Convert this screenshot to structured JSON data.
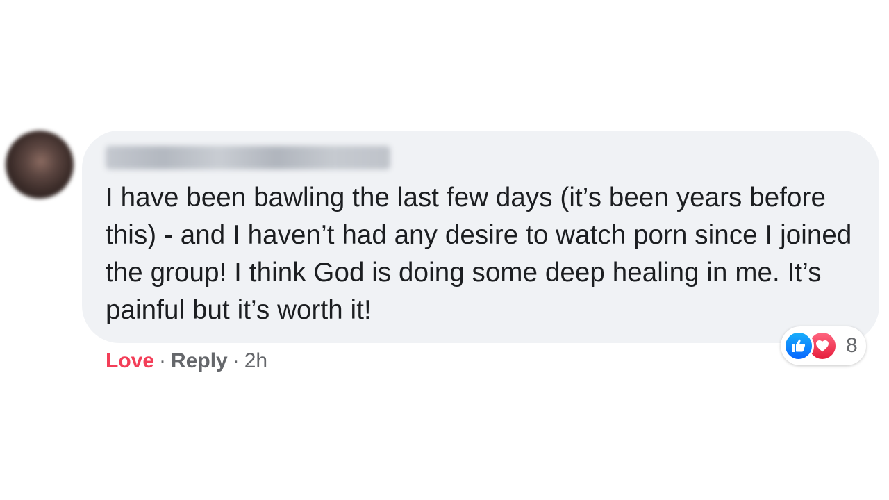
{
  "comment": {
    "author_name": "",
    "text": "I have been bawling the last few days (it’s been years before this) - and I haven’t had any desire to watch porn since I joined the group! I think God is doing some deep healing in me. It’s painful but it’s worth it!",
    "actions": {
      "love_label": "Love",
      "separator": "·",
      "reply_label": "Reply",
      "timestamp": "2h"
    },
    "reactions": {
      "icons": [
        "like-icon",
        "love-icon"
      ],
      "count": "8",
      "colors": {
        "like": "#0866ff",
        "love": "#e61e3c"
      }
    },
    "colors": {
      "bubble_bg": "#f0f2f5",
      "text": "#1c1e21",
      "love_action": "#f33e58",
      "secondary": "#65676b"
    }
  }
}
